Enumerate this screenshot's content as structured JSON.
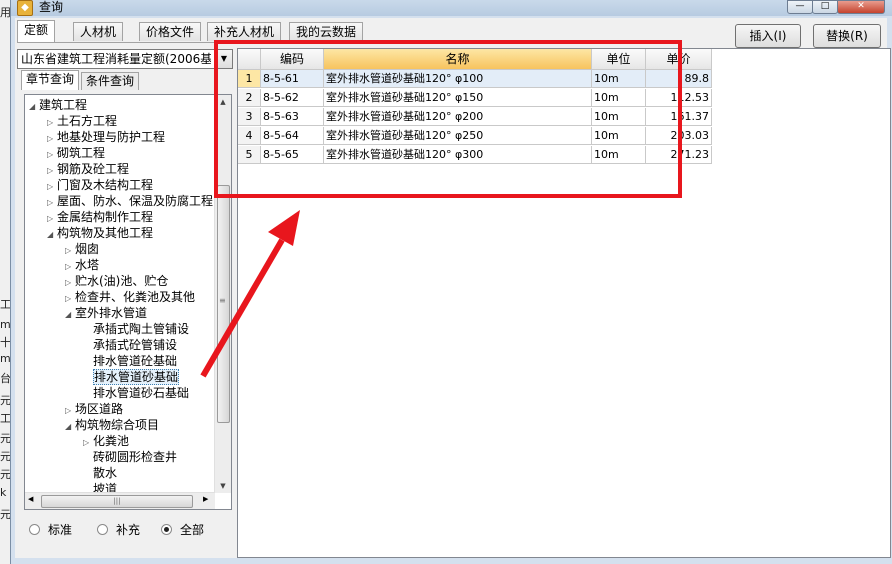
{
  "background": {
    "left_edge_chars": [
      "用",
      "工",
      "m",
      "十",
      "m",
      "台",
      "元",
      "工",
      "元",
      "元",
      "元",
      "k",
      "元"
    ]
  },
  "window": {
    "title": "查询",
    "app_icon": "app-icon",
    "min_icon": "minimize-icon",
    "max_icon": "maximize-icon",
    "close_icon": "close-icon",
    "close_label": "✕"
  },
  "tabs": [
    {
      "label": "定额",
      "active": true
    },
    {
      "label": "人材机",
      "active": false
    },
    {
      "label": "价格文件",
      "active": false
    },
    {
      "label": "补充人材机",
      "active": false
    },
    {
      "label": "我的云数据",
      "active": false
    }
  ],
  "buttons": {
    "insert": "插入(I)",
    "replace": "替换(R)"
  },
  "quota_selector": {
    "value": "山东省建筑工程消耗量定额(2006基价)"
  },
  "subtabs": [
    {
      "label": "章节查询",
      "active": true
    },
    {
      "label": "条件查询",
      "active": false
    }
  ],
  "tree": [
    {
      "label": "建筑工程",
      "level": 0,
      "expanded": true
    },
    {
      "label": "土石方工程",
      "level": 1,
      "expanded": false
    },
    {
      "label": "地基处理与防护工程",
      "level": 1,
      "expanded": false
    },
    {
      "label": "砌筑工程",
      "level": 1,
      "expanded": false
    },
    {
      "label": "钢筋及砼工程",
      "level": 1,
      "expanded": false
    },
    {
      "label": "门窗及木结构工程",
      "level": 1,
      "expanded": false
    },
    {
      "label": "屋面、防水、保温及防腐工程",
      "level": 1,
      "expanded": false
    },
    {
      "label": "金属结构制作工程",
      "level": 1,
      "expanded": false
    },
    {
      "label": "构筑物及其他工程",
      "level": 1,
      "expanded": true
    },
    {
      "label": "烟囱",
      "level": 2,
      "expanded": false
    },
    {
      "label": "水塔",
      "level": 2,
      "expanded": false
    },
    {
      "label": "贮水(油)池、贮仓",
      "level": 2,
      "expanded": false
    },
    {
      "label": "检查井、化粪池及其他",
      "level": 2,
      "expanded": false
    },
    {
      "label": "室外排水管道",
      "level": 2,
      "expanded": true
    },
    {
      "label": "承插式陶土管铺设",
      "level": 3,
      "leaf": true
    },
    {
      "label": "承插式砼管铺设",
      "level": 3,
      "leaf": true
    },
    {
      "label": "排水管道砼基础",
      "level": 3,
      "leaf": true
    },
    {
      "label": "排水管道砂基础",
      "level": 3,
      "leaf": true,
      "selected": true
    },
    {
      "label": "排水管道砂石基础",
      "level": 3,
      "leaf": true
    },
    {
      "label": "场区道路",
      "level": 2,
      "expanded": false
    },
    {
      "label": "构筑物综合项目",
      "level": 2,
      "expanded": true
    },
    {
      "label": "化粪池",
      "level": 3,
      "expanded": false
    },
    {
      "label": "砖砌圆形检查井",
      "level": 3,
      "leaf": true
    },
    {
      "label": "散水",
      "level": 3,
      "leaf": true
    },
    {
      "label": "坡道",
      "level": 3,
      "leaf": true
    }
  ],
  "scroll_grip": "≡",
  "hscroll_grip": "|||",
  "filter": {
    "options": [
      {
        "label": "标准",
        "checked": false
      },
      {
        "label": "补充",
        "checked": false
      },
      {
        "label": "全部",
        "checked": true
      }
    ]
  },
  "grid": {
    "columns": [
      "编码",
      "名称",
      "单位",
      "单价"
    ],
    "rows": [
      {
        "num": "1",
        "code": "8-5-61",
        "name": "室外排水管道砂基础120° φ100",
        "unit": "10m",
        "price": "89.8"
      },
      {
        "num": "2",
        "code": "8-5-62",
        "name": "室外排水管道砂基础120° φ150",
        "unit": "10m",
        "price": "112.53"
      },
      {
        "num": "3",
        "code": "8-5-63",
        "name": "室外排水管道砂基础120° φ200",
        "unit": "10m",
        "price": "161.37"
      },
      {
        "num": "4",
        "code": "8-5-64",
        "name": "室外排水管道砂基础120° φ250",
        "unit": "10m",
        "price": "203.03"
      },
      {
        "num": "5",
        "code": "8-5-65",
        "name": "室外排水管道砂基础120° φ300",
        "unit": "10m",
        "price": "271.23"
      }
    ]
  },
  "annotation": {
    "color": "#e8161d"
  }
}
